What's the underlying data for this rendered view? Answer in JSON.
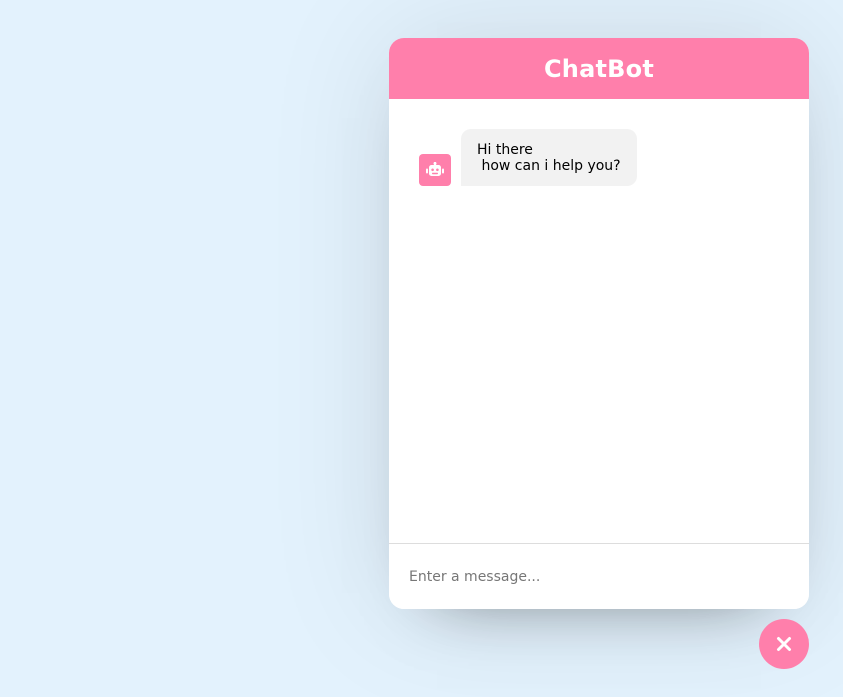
{
  "header": {
    "title": "ChatBot"
  },
  "messages": [
    {
      "sender": "bot",
      "icon": "robot-icon",
      "text": "Hi there\n how can i help you?"
    }
  ],
  "input": {
    "placeholder": "Enter a message...",
    "value": ""
  },
  "toggler": {
    "icon": "close-icon"
  },
  "colors": {
    "accent": "#ff7fab",
    "background": "#e3f2fd",
    "bubble": "#f2f2f2"
  }
}
